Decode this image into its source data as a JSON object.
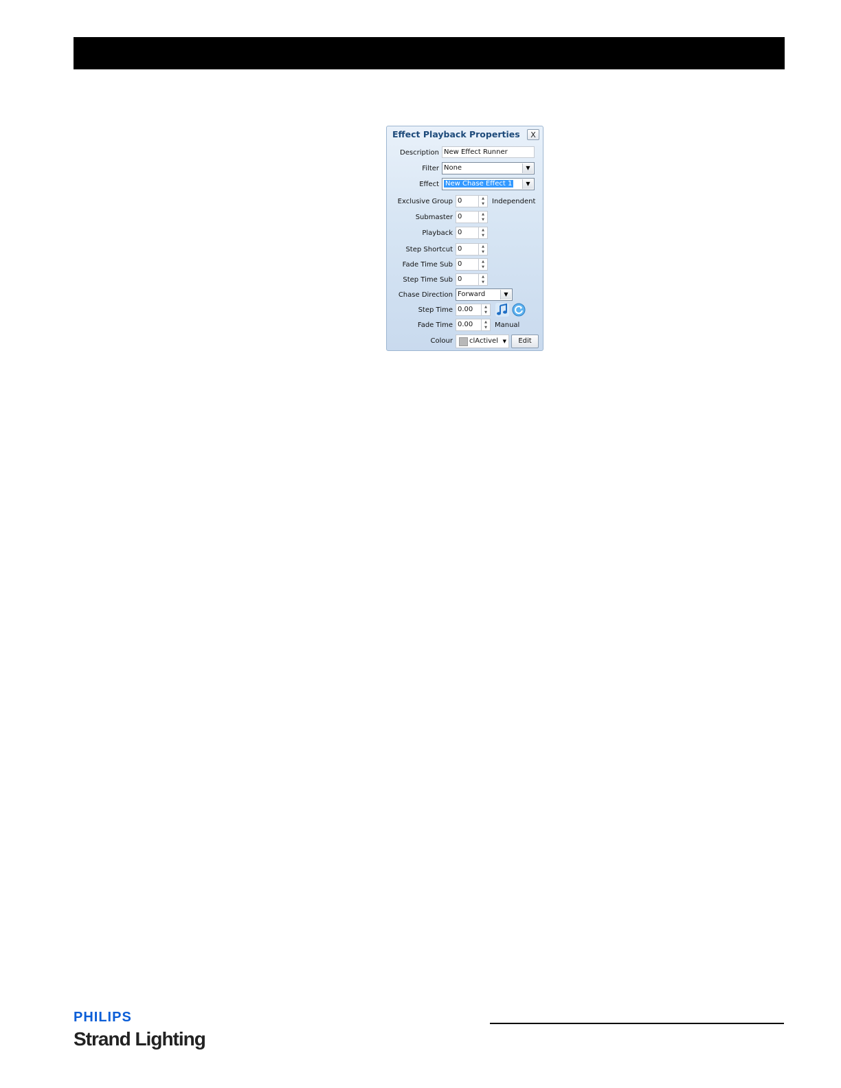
{
  "dialog": {
    "title": "Effect Playback Properties",
    "close_label": "X",
    "description": {
      "label": "Description",
      "value": "New Effect Runner"
    },
    "filter": {
      "label": "Filter",
      "value": "None"
    },
    "effect": {
      "label": "Effect",
      "value": "New Chase Effect 1"
    },
    "exclusive_group": {
      "label": "Exclusive Group",
      "value": "0",
      "note": "Independent"
    },
    "submaster": {
      "label": "Submaster",
      "value": "0"
    },
    "playback": {
      "label": "Playback",
      "value": "0"
    },
    "step_shortcut": {
      "label": "Step Shortcut",
      "value": "0"
    },
    "fade_time_sub": {
      "label": "Fade Time Sub",
      "value": "0"
    },
    "step_time_sub": {
      "label": "Step Time Sub",
      "value": "0"
    },
    "chase_direction": {
      "label": "Chase Direction",
      "value": "Forward"
    },
    "step_time": {
      "label": "Step Time",
      "value": "0.00"
    },
    "fade_time": {
      "label": "Fade Time",
      "value": "0.00",
      "note": "Manual"
    },
    "colour": {
      "label": "Colour",
      "value": "clActivel",
      "swatch": "#b8b8b8"
    },
    "edit_label": "Edit"
  },
  "footer": {
    "brand": "PHILIPS",
    "sub": "Strand Lighting"
  },
  "colors": {
    "accent": "#1d4a7a",
    "brand": "#0b5ed7"
  }
}
